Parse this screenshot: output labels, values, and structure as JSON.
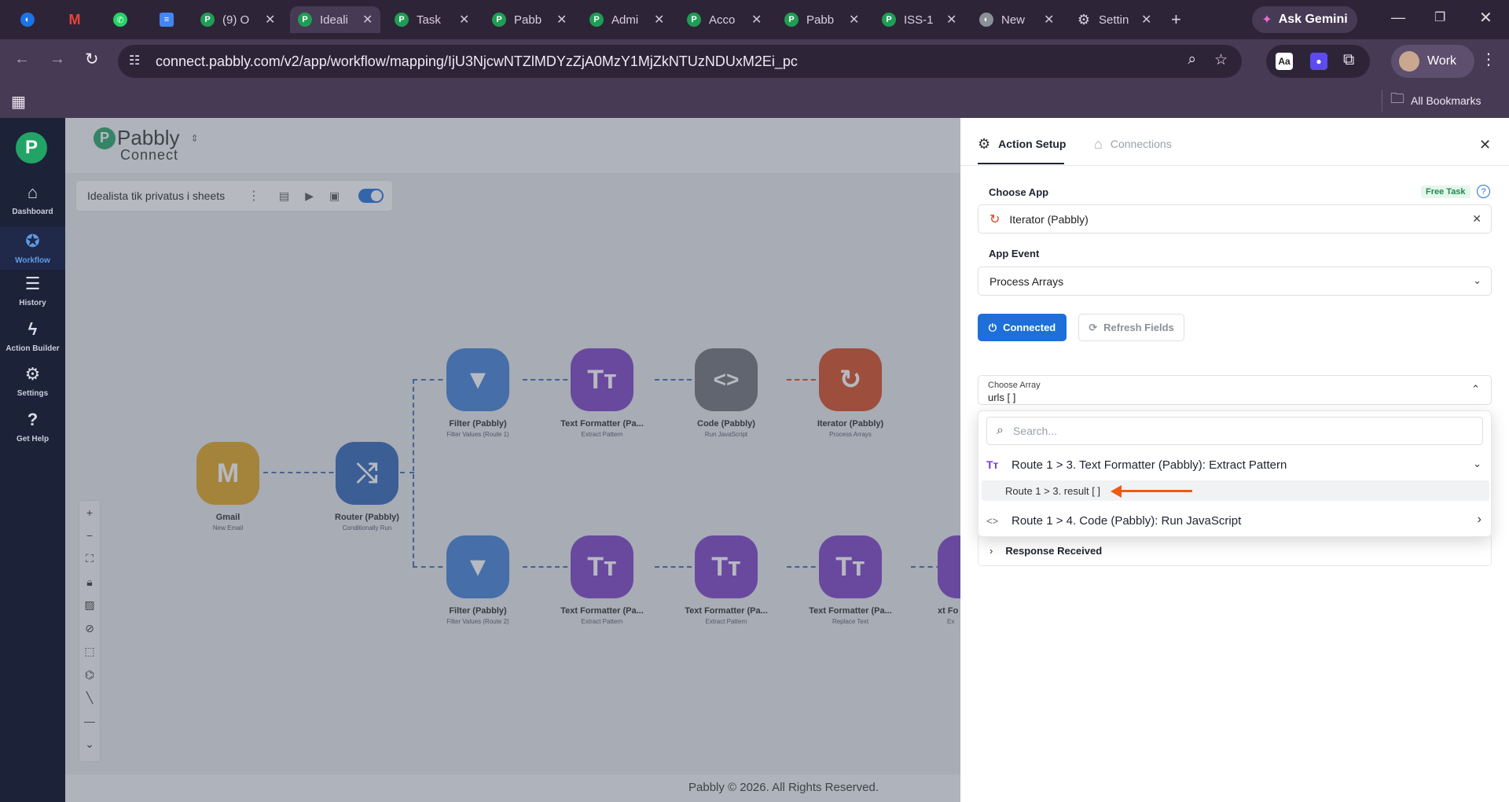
{
  "browser": {
    "tabs": [
      {
        "label": "",
        "icon": "chrome-icon"
      },
      {
        "label": "",
        "icon": "gmail-icon"
      },
      {
        "label": "",
        "icon": "whatsapp-icon"
      },
      {
        "label": "",
        "icon": "docs-icon"
      },
      {
        "label": "(9) O",
        "icon": "pabbly-icon"
      },
      {
        "label": "Ideali",
        "icon": "pabbly-icon"
      },
      {
        "label": "Task",
        "icon": "pabbly-icon"
      },
      {
        "label": "Pabb",
        "icon": "pabbly-icon"
      },
      {
        "label": "Admi",
        "icon": "pabbly-icon"
      },
      {
        "label": "Acco",
        "icon": "pabbly-icon"
      },
      {
        "label": "Pabb",
        "icon": "pabbly-icon"
      },
      {
        "label": "ISS-1",
        "icon": "pabbly-icon"
      },
      {
        "label": "New",
        "icon": "chrome-icon"
      },
      {
        "label": "Settin",
        "icon": "gear-icon"
      }
    ],
    "gemini_label": "Ask Gemini",
    "url": "connect.pabbly.com/v2/app/workflow/mapping/IjU3NjcwNTZlMDYzZjA0MzY1MjZkNTUzNDUxM2Ei_pc",
    "profile_label": "Work",
    "bookmarks_label": "All Bookmarks"
  },
  "sidebar": {
    "items": [
      {
        "label": "Dashboard"
      },
      {
        "label": "Workflow"
      },
      {
        "label": "History"
      },
      {
        "label": "Action Builder"
      },
      {
        "label": "Settings"
      },
      {
        "label": "Get Help"
      }
    ]
  },
  "canvas": {
    "logo_top": "Pabbly",
    "logo_bottom": "Connect",
    "workflow_name": "Idealista tik privatus i sheets",
    "footer": "Pabbly © 2026. All Rights Reserved.",
    "nodes": [
      {
        "name": "Gmail",
        "sub": "New Email",
        "color": "#e1a21a",
        "glyph": "M"
      },
      {
        "name": "Router (Pabbly)",
        "sub": "Conditionally Run",
        "color": "#2b63b6",
        "glyph": "⤭"
      },
      {
        "name": "Filter (Pabbly)",
        "sub": "Filter Values (Route 1)",
        "color": "#3f7fd6",
        "glyph": "▼"
      },
      {
        "name": "Text Formatter (Pa...",
        "sub": "Extract Pattern",
        "color": "#7a3ec4",
        "glyph": "Tт"
      },
      {
        "name": "Code (Pabbly)",
        "sub": "Run JavaScript",
        "color": "#6b6e75",
        "glyph": "<>"
      },
      {
        "name": "Iterator (Pabbly)",
        "sub": "Process Arrays",
        "color": "#d4471e",
        "glyph": "↻"
      },
      {
        "name": "Filter (Pabbly)",
        "sub": "Filter Values (Route 2)",
        "color": "#3f7fd6",
        "glyph": "▼"
      },
      {
        "name": "Text Formatter (Pa...",
        "sub": "Extract Pattern",
        "color": "#7a3ec4",
        "glyph": "Tт"
      },
      {
        "name": "Text Formatter (Pa...",
        "sub": "Extract Pattern",
        "color": "#7a3ec4",
        "glyph": "Tт"
      },
      {
        "name": "Text Formatter (Pa...",
        "sub": "Replace Text",
        "color": "#7a3ec4",
        "glyph": "Tт"
      },
      {
        "name": "Text Fo",
        "sub": "Ex",
        "color": "#7a3ec4",
        "glyph": "T"
      }
    ]
  },
  "panel": {
    "tab_setup": "Action Setup",
    "tab_connections": "Connections",
    "choose_app_label": "Choose App",
    "free_task": "Free Task",
    "app_value": "Iterator (Pabbly)",
    "app_event_label": "App Event",
    "app_event_value": "Process Arrays",
    "connected_label": "Connected",
    "refresh_label": "Refresh Fields",
    "choose_array_label": "Choose Array",
    "choose_array_value": "urls [ ]",
    "search_placeholder": "Search...",
    "option_group_1": "Route 1 > 3. Text Formatter (Pabbly): Extract Pattern",
    "option_sub_1": "Route 1 > 3. result [ ]",
    "option_group_2": "Route 1 > 4. Code (Pabbly): Run JavaScript",
    "response_label": "Response Received"
  }
}
